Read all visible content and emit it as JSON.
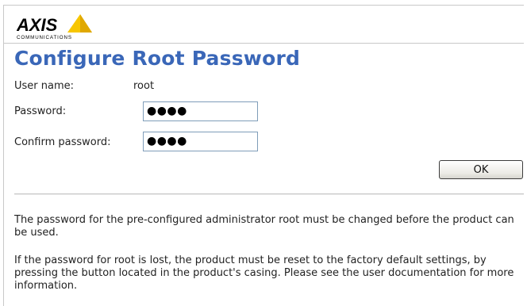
{
  "brand": {
    "logo_text": "AXIS",
    "logo_subtext": "COMMUNICATIONS",
    "colors": {
      "logo_triangle": "#f7c600",
      "logo_text": "#000000"
    }
  },
  "page": {
    "title": "Configure Root Password",
    "title_color": "#3a67b8"
  },
  "form": {
    "username_label": "User name:",
    "username_value": "root",
    "password_label": "Password:",
    "password_value": "●●●●",
    "confirm_label": "Confirm password:",
    "confirm_value": "●●●●",
    "ok_label": "OK"
  },
  "info": {
    "paragraph1": "The password for the pre-configured administrator root must be changed before the product can be used.",
    "paragraph2": "If the password for root is lost, the product must be reset to the factory default settings, by pressing the button located in the product's casing. Please see the user documentation for more information."
  }
}
